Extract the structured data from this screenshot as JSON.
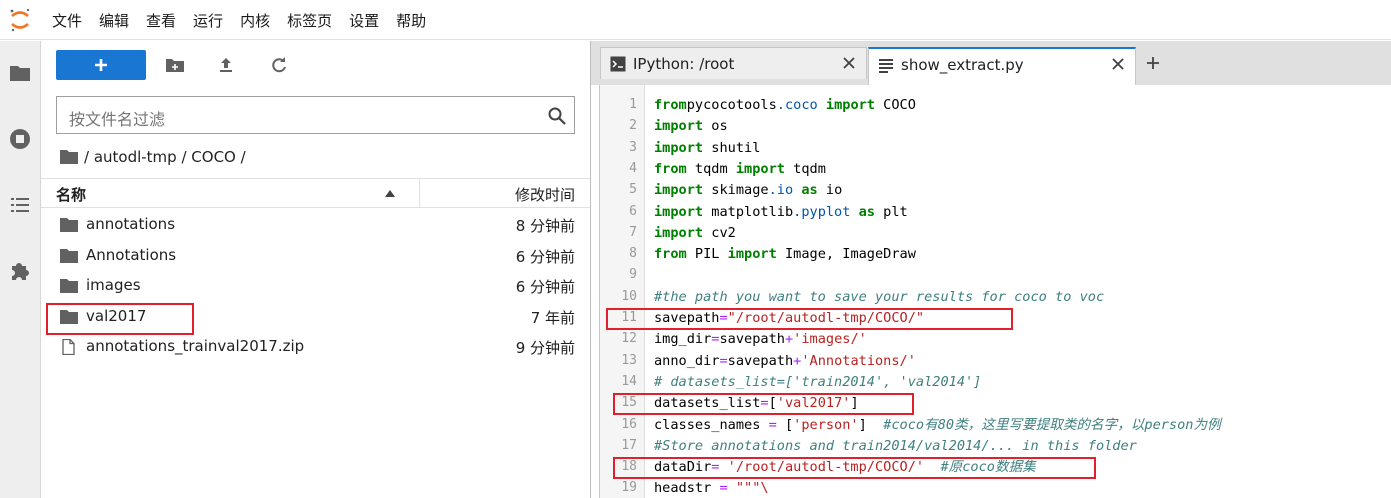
{
  "menu": [
    "文件",
    "编辑",
    "查看",
    "运行",
    "内核",
    "标签页",
    "设置",
    "帮助"
  ],
  "filebrowser": {
    "new_button_label": "+",
    "search_placeholder": "按文件名过滤",
    "breadcrumb": "/ autodl-tmp / COCO /",
    "col_name": "名称",
    "col_modified": "修改时间",
    "files": [
      {
        "name": "annotations",
        "type": "folder",
        "modified": "8 分钟前"
      },
      {
        "name": "Annotations",
        "type": "folder",
        "modified": "6 分钟前"
      },
      {
        "name": "images",
        "type": "folder",
        "modified": "6 分钟前"
      },
      {
        "name": "val2017",
        "type": "folder",
        "modified": "7 年前",
        "highlighted": true
      },
      {
        "name": "annotations_trainval2017.zip",
        "type": "file",
        "modified": "9 分钟前"
      }
    ]
  },
  "tabs": [
    {
      "title": "IPython: /root",
      "icon": "terminal-icon",
      "active": false
    },
    {
      "title": "show_extract.py",
      "icon": "text-file-icon",
      "active": true
    }
  ],
  "editor": {
    "lines": [
      [
        [
          "kw",
          "from"
        ],
        [
          "",
          "pycocotools"
        ],
        [
          "mod",
          ".coco"
        ],
        [
          "",
          ""
        ],
        [
          "kw",
          " import"
        ],
        [
          "",
          " COCO"
        ]
      ],
      [
        [
          "kw",
          "import"
        ],
        [
          "",
          " os"
        ]
      ],
      [
        [
          "kw",
          "import"
        ],
        [
          "",
          " shutil"
        ]
      ],
      [
        [
          "kw",
          "from"
        ],
        [
          "",
          " tqdm "
        ],
        [
          "kw",
          "import"
        ],
        [
          "",
          " tqdm"
        ]
      ],
      [
        [
          "kw",
          "import"
        ],
        [
          "",
          " skimage"
        ],
        [
          "mod",
          ".io"
        ],
        [
          "kw",
          " as"
        ],
        [
          "",
          " io"
        ]
      ],
      [
        [
          "kw",
          "import"
        ],
        [
          "",
          " matplotlib"
        ],
        [
          "mod",
          ".pyplot"
        ],
        [
          "kw",
          " as"
        ],
        [
          "",
          " plt"
        ]
      ],
      [
        [
          "kw",
          "import"
        ],
        [
          "",
          " cv2"
        ]
      ],
      [
        [
          "kw",
          "from"
        ],
        [
          "",
          " PIL "
        ],
        [
          "kw",
          "import"
        ],
        [
          "",
          " Image, ImageDraw"
        ]
      ],
      [],
      [
        [
          "cm",
          "#the path you want to save your results for coco to voc"
        ]
      ],
      [
        [
          "",
          "savepath"
        ],
        [
          "op",
          "="
        ],
        [
          "st",
          "\"/root/autodl-tmp/COCO/\""
        ]
      ],
      [
        [
          "",
          "img_dir"
        ],
        [
          "op",
          "="
        ],
        [
          "",
          "savepath"
        ],
        [
          "op",
          "+"
        ],
        [
          "st",
          "'images/'"
        ]
      ],
      [
        [
          "",
          "anno_dir"
        ],
        [
          "op",
          "="
        ],
        [
          "",
          "savepath"
        ],
        [
          "op",
          "+"
        ],
        [
          "st",
          "'Annotations/'"
        ]
      ],
      [
        [
          "cm",
          "# datasets_list=['train2014', 'val2014']"
        ]
      ],
      [
        [
          "",
          "datasets_list"
        ],
        [
          "op",
          "="
        ],
        [
          "",
          "["
        ],
        [
          "st",
          "'val2017'"
        ],
        [
          "",
          "]"
        ]
      ],
      [
        [
          "",
          "classes_names "
        ],
        [
          "op",
          "="
        ],
        [
          "",
          " ["
        ],
        [
          "st",
          "'person'"
        ],
        [
          "",
          "]  "
        ],
        [
          "cm",
          "#coco有80类，这里写要提取类的名字，以person为例"
        ]
      ],
      [
        [
          "cm",
          "#Store annotations and train2014/val2014/... in this folder"
        ]
      ],
      [
        [
          "",
          "dataDir"
        ],
        [
          "op",
          "="
        ],
        [
          "",
          " "
        ],
        [
          "st",
          "'/root/autodl-tmp/COCO/'"
        ],
        [
          "",
          "  "
        ],
        [
          "cm",
          "#原coco数据集"
        ]
      ],
      [
        [
          "",
          "headstr "
        ],
        [
          "op",
          "="
        ],
        [
          "",
          " "
        ],
        [
          "st",
          "\"\"\"\\"
        ]
      ]
    ]
  },
  "colors": {
    "accent": "#1976d2",
    "highlight": "#e0202a",
    "keyword": "#008000",
    "string": "#ba2121",
    "comment": "#408080",
    "operator": "#aa22ff"
  }
}
